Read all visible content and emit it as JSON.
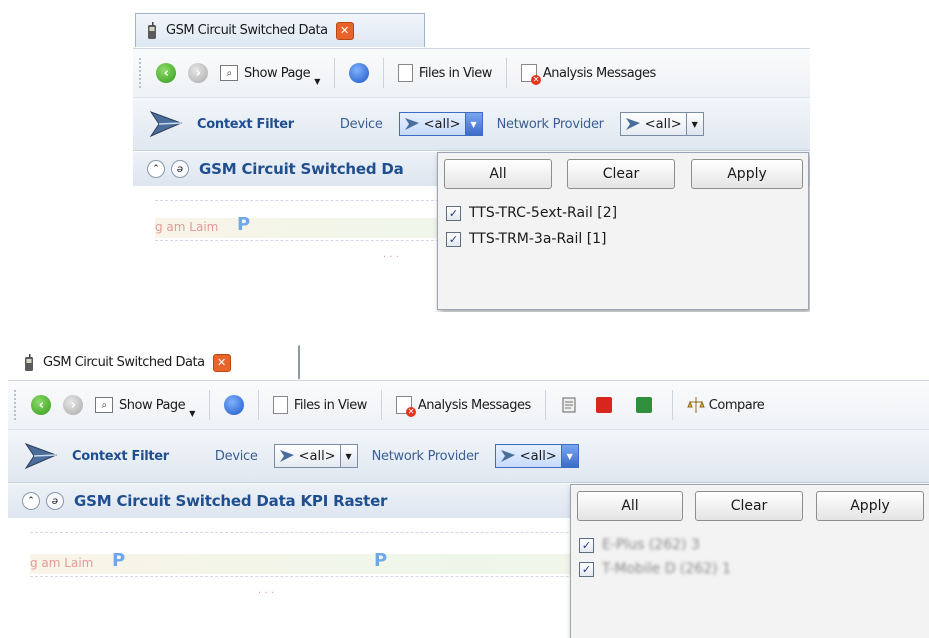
{
  "colors": {
    "accent_blue": "#1f4f8f",
    "label_blue": "#3a5f94",
    "close_orange": "#e8642a",
    "toolbar_bg": "#eef1f5",
    "pdf_red": "#d8261c",
    "excel_green": "#2f8f3a"
  },
  "top": {
    "tab": {
      "label": "GSM Circuit Switched Data",
      "icon": "phone-icon",
      "close_icon": "close-icon"
    },
    "toolbar": {
      "back_icon": "back-arrow-icon",
      "forward_icon": "forward-arrow-icon",
      "show_page_label": "Show Page",
      "globe_icon": "globe-icon",
      "files_in_view_label": "Files in View",
      "analysis_messages_label": "Analysis Messages"
    },
    "filter": {
      "label": "Context Filter",
      "device_label": "Device",
      "device_value": "<all>",
      "network_provider_label": "Network Provider",
      "network_provider_value": "<all>"
    },
    "panel_title": "GSM Circuit Switched Da",
    "raster": {
      "label_left": "g am Laim",
      "marker": "P"
    },
    "popup": {
      "buttons": {
        "all": "All",
        "clear": "Clear",
        "apply": "Apply"
      },
      "items": [
        {
          "label": "TTS-TRC-5ext-Rail [2]",
          "checked": true
        },
        {
          "label": "TTS-TRM-3a-Rail [1]",
          "checked": true
        }
      ]
    }
  },
  "bottom": {
    "tab": {
      "label": "GSM Circuit Switched Data",
      "icon": "phone-icon",
      "close_icon": "close-icon"
    },
    "toolbar": {
      "back_icon": "back-arrow-icon",
      "forward_icon": "forward-arrow-icon",
      "show_page_label": "Show Page",
      "globe_icon": "globe-icon",
      "files_in_view_label": "Files in View",
      "analysis_messages_label": "Analysis Messages",
      "export_icons": [
        "notes-icon",
        "pdf-icon",
        "excel-icon"
      ],
      "compare_label": "Compare"
    },
    "filter": {
      "label": "Context Filter",
      "device_label": "Device",
      "device_value": "<all>",
      "network_provider_label": "Network Provider",
      "network_provider_value": "<all>"
    },
    "panel_title": "GSM Circuit Switched Data KPI Raster",
    "raster": {
      "label_left": "g am Laim",
      "marker": "P"
    },
    "popup": {
      "buttons": {
        "all": "All",
        "clear": "Clear",
        "apply": "Apply"
      },
      "items": [
        {
          "label": "E-Plus (262) 3",
          "checked": true
        },
        {
          "label": "T-Mobile D (262) 1",
          "checked": true
        }
      ]
    }
  }
}
